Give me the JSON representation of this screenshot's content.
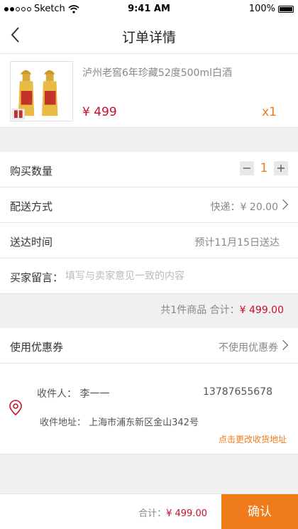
{
  "status_bar": {
    "carrier": "Sketch",
    "time": "9:41 AM",
    "battery": "100%"
  },
  "nav": {
    "title": "订单详情",
    "back_icon": "chevron-left"
  },
  "product": {
    "name": "泸州老窖6年珍藏52度500ml白酒",
    "price": "¥ 499",
    "quantity": "x1"
  },
  "purchase_qty": {
    "label": "购买数量",
    "minus": "−",
    "value": "1",
    "plus": "+"
  },
  "shipping": {
    "label": "配送方式",
    "value": "快递：¥  20.00"
  },
  "delivery": {
    "label": "送达时间",
    "value": "预计11月15日送达"
  },
  "message": {
    "label": "买家留言：",
    "placeholder": "填写与卖家意见一致的内容"
  },
  "summary": {
    "prefix": "共1件商品    合计：",
    "amount": "¥ 499.00"
  },
  "coupon": {
    "label": "使用优惠券",
    "value": "不使用优惠券"
  },
  "address": {
    "recipient": "收件人：  李一一",
    "phone": "13787655678",
    "line": "收件地址：  上海市浦东新区金山342号",
    "change_link": "点击更改收货地址"
  },
  "footer": {
    "total_label": "合计：",
    "total_amount": "¥ 499.00",
    "confirm": "确认"
  },
  "colors": {
    "accent": "#f07b1a",
    "price": "#c8102e",
    "background": "#f0f0f0"
  }
}
